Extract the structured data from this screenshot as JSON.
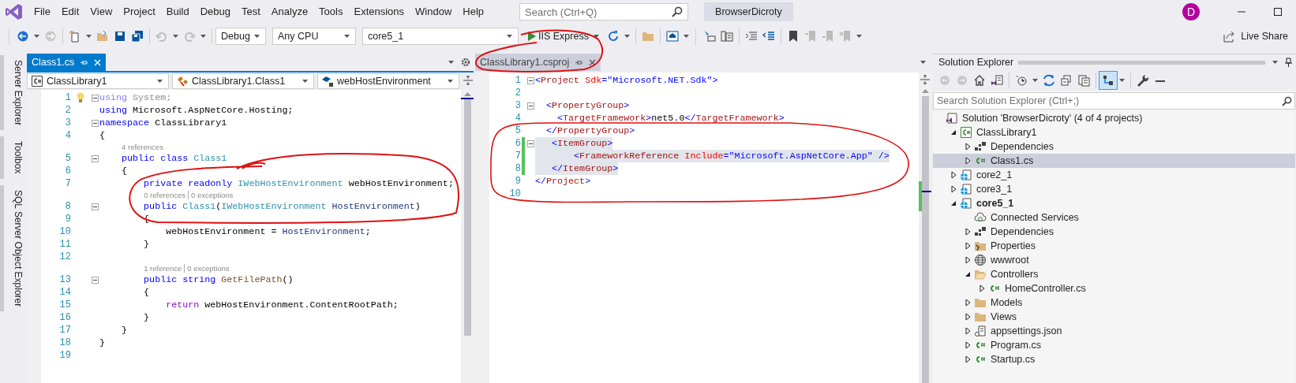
{
  "menu": [
    "File",
    "Edit",
    "View",
    "Project",
    "Build",
    "Debug",
    "Test",
    "Analyze",
    "Tools",
    "Extensions",
    "Window",
    "Help"
  ],
  "search": {
    "placeholder": "Search (Ctrl+Q)"
  },
  "solution_name": "BrowserDicroty",
  "avatar": "D",
  "toolbar": {
    "configuration": "Debug",
    "platform": "Any CPU",
    "startup_project": "core5_1",
    "run": "IIS Express",
    "live_share": "Live Share"
  },
  "side_tabs": [
    "Server Explorer",
    "Toolbox",
    "SQL Server Object Explorer"
  ],
  "editors": [
    {
      "tabs": [
        {
          "label": "Class1.cs",
          "selected": true
        }
      ],
      "nav": [
        "ClassLibrary1",
        "ClassLibrary1.Class1",
        "webHostEnvironment"
      ],
      "lines": [
        {
          "n": "1",
          "fold": true,
          "bulb": true,
          "tokens": [
            {
              "kind": "faded-kw",
              "text": "using"
            },
            {
              "kind": "faded",
              "text": " System;"
            }
          ]
        },
        {
          "n": "2",
          "fold": false,
          "bulb": false,
          "tokens": [
            {
              "kind": "kw",
              "text": "using"
            },
            {
              "kind": "plain",
              "text": " Microsoft.AspNetCore.Hosting;"
            }
          ]
        },
        {
          "n": "3",
          "fold": true,
          "bulb": false,
          "tokens": [
            {
              "kind": "kw",
              "text": "namespace"
            },
            {
              "kind": "plain",
              "text": " ClassLibrary1"
            }
          ]
        },
        {
          "n": "4",
          "fold": false,
          "bulb": false,
          "tokens": [
            {
              "kind": "plain",
              "text": "{"
            }
          ]
        },
        {
          "n": "5",
          "fold": true,
          "bulb": false,
          "lens": [
            "4 references"
          ],
          "tokens": [
            {
              "kind": "kw",
              "text": "    public"
            },
            {
              "kind": "kw",
              "text": " class"
            },
            {
              "kind": "type",
              "text": " Class1"
            }
          ]
        },
        {
          "n": "6",
          "fold": false,
          "bulb": false,
          "tokens": [
            {
              "kind": "plain",
              "text": "    {"
            }
          ]
        },
        {
          "n": "7",
          "fold": false,
          "bulb": false,
          "tokens": [
            {
              "kind": "kw",
              "text": "        private"
            },
            {
              "kind": "kw",
              "text": " readonly"
            },
            {
              "kind": "type",
              "text": " IWebHostEnvironment"
            },
            {
              "kind": "plain",
              "text": " webHostEnvironment;"
            }
          ]
        },
        {
          "n": "8",
          "fold": true,
          "bulb": false,
          "lens": [
            "0 references",
            "0 exceptions"
          ],
          "tokens": [
            {
              "kind": "kw",
              "text": "        public"
            },
            {
              "kind": "type",
              "text": " Class1"
            },
            {
              "kind": "plain",
              "text": "("
            },
            {
              "kind": "type",
              "text": "IWebHostEnvironment"
            },
            {
              "kind": "param",
              "text": " HostEnvironment"
            },
            {
              "kind": "plain",
              "text": ")"
            }
          ]
        },
        {
          "n": "9",
          "fold": false,
          "bulb": false,
          "tokens": [
            {
              "kind": "plain",
              "text": "        {"
            }
          ]
        },
        {
          "n": "10",
          "fold": false,
          "bulb": false,
          "tokens": [
            {
              "kind": "plain",
              "text": "            webHostEnvironment = "
            },
            {
              "kind": "param",
              "text": "HostEnvironment"
            },
            {
              "kind": "plain",
              "text": ";"
            }
          ]
        },
        {
          "n": "11",
          "fold": false,
          "bulb": false,
          "tokens": [
            {
              "kind": "plain",
              "text": "        }"
            }
          ]
        },
        {
          "n": "12",
          "fold": false,
          "bulb": false
        },
        {
          "n": "13",
          "fold": true,
          "bulb": false,
          "lens": [
            "1 reference",
            "0 exceptions"
          ],
          "tokens": [
            {
              "kind": "kw",
              "text": "        public"
            },
            {
              "kind": "kw",
              "text": " string"
            },
            {
              "kind": "method",
              "text": " GetFilePath"
            },
            {
              "kind": "plain",
              "text": "()"
            }
          ]
        },
        {
          "n": "14",
          "fold": false,
          "bulb": false,
          "tokens": [
            {
              "kind": "plain",
              "text": "        {"
            }
          ]
        },
        {
          "n": "15",
          "fold": false,
          "bulb": false,
          "tokens": [
            {
              "kind": "control",
              "text": "            return"
            },
            {
              "kind": "plain",
              "text": " webHostEnvironment.ContentRootPath;"
            }
          ]
        },
        {
          "n": "16",
          "fold": false,
          "bulb": false,
          "tokens": [
            {
              "kind": "plain",
              "text": "        }"
            }
          ]
        },
        {
          "n": "17",
          "fold": false,
          "bulb": false,
          "tokens": [
            {
              "kind": "plain",
              "text": "    }"
            }
          ]
        },
        {
          "n": "18",
          "fold": false,
          "bulb": false,
          "tokens": [
            {
              "kind": "plain",
              "text": "}"
            }
          ]
        },
        {
          "n": "19",
          "fold": false,
          "bulb": false
        }
      ]
    },
    {
      "tabs": [
        {
          "label": "ClassLibrary1.csproj",
          "selected": false
        }
      ],
      "lines": [
        {
          "n": "1",
          "fold": true,
          "changed": false,
          "highlighted": false,
          "tokens": [
            {
              "kind": "delim",
              "text": "<"
            },
            {
              "kind": "tag",
              "text": "Project"
            },
            {
              "kind": "attr",
              "text": " Sdk"
            },
            {
              "kind": "delim",
              "text": "=\""
            },
            {
              "kind": "value",
              "text": "Microsoft.NET.Sdk"
            },
            {
              "kind": "delim",
              "text": "\">"
            }
          ]
        },
        {
          "n": "2",
          "fold": false,
          "changed": false,
          "highlighted": false
        },
        {
          "n": "3",
          "fold": true,
          "changed": false,
          "highlighted": false,
          "tokens": [
            {
              "kind": "delim",
              "text": "  <"
            },
            {
              "kind": "tag",
              "text": "PropertyGroup"
            },
            {
              "kind": "delim",
              "text": ">"
            }
          ]
        },
        {
          "n": "4",
          "fold": false,
          "changed": false,
          "highlighted": false,
          "tokens": [
            {
              "kind": "delim",
              "text": "    <"
            },
            {
              "kind": "tag",
              "text": "TargetFramework"
            },
            {
              "kind": "delim",
              "text": ">"
            },
            {
              "kind": "text",
              "text": "net5.0"
            },
            {
              "kind": "delim",
              "text": "</"
            },
            {
              "kind": "tag",
              "text": "TargetFramework"
            },
            {
              "kind": "delim",
              "text": ">"
            }
          ]
        },
        {
          "n": "5",
          "fold": false,
          "changed": false,
          "highlighted": false,
          "tokens": [
            {
              "kind": "delim",
              "text": "  </"
            },
            {
              "kind": "tag",
              "text": "PropertyGroup"
            },
            {
              "kind": "delim",
              "text": ">"
            }
          ]
        },
        {
          "n": "6",
          "fold": true,
          "changed": true,
          "highlighted": true,
          "tokens": [
            {
              "kind": "delim",
              "text": "   <"
            },
            {
              "kind": "tag",
              "text": "ItemGroup"
            },
            {
              "kind": "delim",
              "text": ">"
            }
          ]
        },
        {
          "n": "7",
          "fold": false,
          "changed": true,
          "highlighted": true,
          "tokens": [
            {
              "kind": "delim",
              "text": "       <"
            },
            {
              "kind": "tag",
              "text": "FrameworkReference"
            },
            {
              "kind": "attr",
              "text": " Include"
            },
            {
              "kind": "delim",
              "text": "=\""
            },
            {
              "kind": "value",
              "text": "Microsoft.AspNetCore.App"
            },
            {
              "kind": "delim",
              "text": "\" />"
            }
          ]
        },
        {
          "n": "8",
          "fold": false,
          "changed": true,
          "highlighted": true,
          "tokens": [
            {
              "kind": "delim",
              "text": "   </"
            },
            {
              "kind": "tag",
              "text": "ItemGroup"
            },
            {
              "kind": "delim",
              "text": ">"
            }
          ]
        },
        {
          "n": "9",
          "fold": false,
          "changed": false,
          "highlighted": false,
          "tokens": [
            {
              "kind": "delim",
              "text": "</"
            },
            {
              "kind": "tag",
              "text": "Project"
            },
            {
              "kind": "delim",
              "text": ">"
            }
          ]
        },
        {
          "n": "10",
          "fold": false,
          "changed": false,
          "highlighted": false
        }
      ]
    }
  ],
  "solution_explorer": {
    "title": "Solution Explorer",
    "search_placeholder": "Search Solution Explorer (Ctrl+;)",
    "tree": [
      {
        "label": "Solution 'BrowserDicroty' (4 of 4 projects)",
        "kind": "solution",
        "expandable": false,
        "selected": false,
        "startup": false,
        "children": [
          {
            "label": "ClassLibrary1",
            "kind": "csproj",
            "expandable": true,
            "expanded": true,
            "selected": false,
            "startup": false,
            "children": [
              {
                "label": "Dependencies",
                "kind": "deps",
                "expandable": true,
                "expanded": false,
                "selected": false,
                "startup": false
              },
              {
                "label": "Class1.cs",
                "kind": "csfile",
                "expandable": true,
                "expanded": false,
                "selected": true,
                "startup": false
              }
            ]
          },
          {
            "label": "core2_1",
            "kind": "webproj",
            "expandable": true,
            "expanded": false,
            "selected": false,
            "startup": false
          },
          {
            "label": "core3_1",
            "kind": "webproj",
            "expandable": true,
            "expanded": false,
            "selected": false,
            "startup": false
          },
          {
            "label": "core5_1",
            "kind": "webproj",
            "expandable": true,
            "expanded": true,
            "selected": false,
            "startup": true,
            "children": [
              {
                "label": "Connected Services",
                "kind": "connected",
                "expandable": false,
                "selected": false,
                "startup": false
              },
              {
                "label": "Dependencies",
                "kind": "deps",
                "expandable": true,
                "expanded": false,
                "selected": false,
                "startup": false
              },
              {
                "label": "Properties",
                "kind": "props",
                "expandable": true,
                "expanded": false,
                "selected": false,
                "startup": false
              },
              {
                "label": "wwwroot",
                "kind": "globe",
                "expandable": true,
                "expanded": false,
                "selected": false,
                "startup": false
              },
              {
                "label": "Controllers",
                "kind": "folderopen",
                "expandable": true,
                "expanded": true,
                "selected": false,
                "startup": false,
                "children": [
                  {
                    "label": "HomeController.cs",
                    "kind": "csfile",
                    "expandable": true,
                    "expanded": false,
                    "selected": false,
                    "startup": false
                  }
                ]
              },
              {
                "label": "Models",
                "kind": "folder",
                "expandable": true,
                "expanded": false,
                "selected": false,
                "startup": false
              },
              {
                "label": "Views",
                "kind": "folder",
                "expandable": true,
                "expanded": false,
                "selected": false,
                "startup": false
              },
              {
                "label": "appsettings.json",
                "kind": "json",
                "expandable": true,
                "expanded": false,
                "selected": false,
                "startup": false
              },
              {
                "label": "Program.cs",
                "kind": "csfile",
                "expandable": true,
                "expanded": false,
                "selected": false,
                "startup": false
              },
              {
                "label": "Startup.cs",
                "kind": "csfile",
                "expandable": true,
                "expanded": false,
                "selected": false,
                "startup": false
              }
            ]
          }
        ]
      }
    ]
  }
}
